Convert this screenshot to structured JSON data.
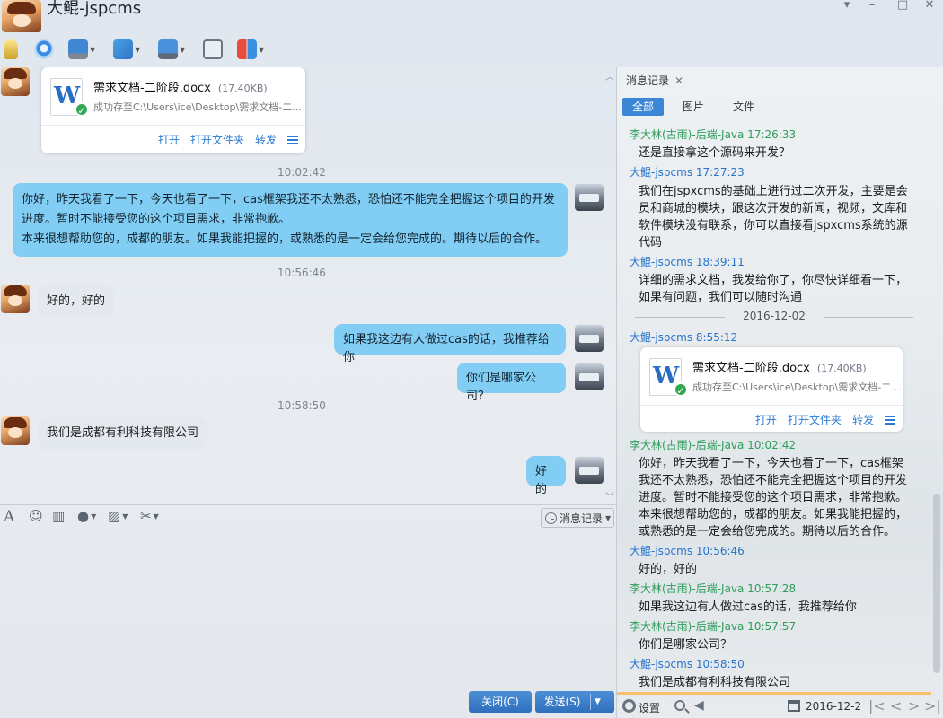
{
  "window": {
    "title": "大鲲-jspcms",
    "controls": [
      "▾",
      "–",
      "□",
      "✕"
    ]
  },
  "toolbar": {
    "items": [
      "mic-icon",
      "camera-icon",
      "screen-share-icon",
      "file-transfer-icon",
      "remote-desktop-icon",
      "message-add-icon",
      "apps-icon"
    ]
  },
  "chat": {
    "file_card": {
      "name": "需求文档-二阶段.docx",
      "size": "(17.40KB)",
      "saved": "成功存至C:\\Users\\ice\\Desktop\\需求文档-二...",
      "actions": [
        "打开",
        "打开文件夹",
        "转发"
      ]
    },
    "messages": [
      {
        "time": "10:02:42"
      },
      {
        "from": "self",
        "lines": [
          "你好，昨天我看了一下，今天也看了一下，cas框架我还不太熟悉，恐怕还不能完全把握这个项目的开发",
          "进度。暂时不能接受您的这个项目需求，非常抱歉。",
          "本来很想帮助您的，成都的朋友。如果我能把握的，或熟悉的是一定会给您完成的。期待以后的合作。"
        ]
      },
      {
        "time": "10:56:46"
      },
      {
        "from": "peer",
        "text": "好的，好的"
      },
      {
        "from": "self",
        "text": "如果我这边有人做过cas的话，我推荐给你"
      },
      {
        "from": "self",
        "text": "你们是哪家公司？"
      },
      {
        "time": "10:58:50"
      },
      {
        "from": "peer",
        "text": "我们是成都有利科技有限公司"
      },
      {
        "from": "self",
        "text": "好的"
      }
    ]
  },
  "input_bar": {
    "icons": [
      "font-icon",
      "emoji-icon",
      "screenshot-icon",
      "voice-icon",
      "image-icon",
      "scissors-icon"
    ],
    "history_button": "消息记录"
  },
  "buttons": {
    "close": "关闭(C)",
    "send": "发送(S)"
  },
  "history": {
    "tab_label": "消息记录",
    "filters": [
      "全部",
      "图片",
      "文件"
    ],
    "entries": [
      {
        "sender": "李大林(古雨)-后端-Java 17:26:33",
        "color": "green",
        "lines": [
          "还是直接拿这个源码来开发？"
        ]
      },
      {
        "sender": "大鲲-jspcms 17:27:23",
        "color": "blue",
        "lines": [
          "我们在jspxcms的基础上进行过二次开发，主要是会",
          "员和商城的模块，跟这次开发的新闻，视频，文库和",
          "软件模块没有联系，你可以直接看jspxcms系统的源",
          "代码"
        ]
      },
      {
        "sender": "大鲲-jspcms 18:39:11",
        "color": "blue",
        "lines": [
          "详细的需求文档，我发给你了，你尽快详细看一下，",
          "如果有问题，我们可以随时沟通"
        ]
      },
      {
        "date": "2016-12-02"
      },
      {
        "sender": "大鲲-jspcms 8:55:12",
        "color": "blue",
        "file": true
      },
      {
        "sender": "李大林(古雨)-后端-Java 10:02:42",
        "color": "green",
        "lines": [
          "你好，昨天我看了一下，今天也看了一下，cas框架",
          "我还不太熟悉，恐怕还不能完全把握这个项目的开发",
          "进度。暂时不能接受您的这个项目需求，非常抱歉。",
          "本来很想帮助您的，成都的朋友。如果我能把握的，",
          "或熟悉的是一定会给您完成的。期待以后的合作。"
        ]
      },
      {
        "sender": "大鲲-jspcms 10:56:46",
        "color": "blue",
        "lines": [
          "好的，好的"
        ]
      },
      {
        "sender": "李大林(古雨)-后端-Java 10:57:28",
        "color": "green",
        "lines": [
          "如果我这边有人做过cas的话，我推荐给你"
        ]
      },
      {
        "sender": "李大林(古雨)-后端-Java 10:57:57",
        "color": "green",
        "lines": [
          "你们是哪家公司？"
        ]
      },
      {
        "sender": "大鲲-jspcms 10:58:50",
        "color": "blue",
        "lines": [
          "我们是成都有利科技有限公司"
        ]
      }
    ],
    "bottom": {
      "settings_label": "设置",
      "date": "2016-12-2"
    }
  },
  "colors": {
    "bubble_out": "#82cdf3",
    "bubble_in": "#e3e9ef",
    "primary_button": "#3b7fcd",
    "sender_green": "#2e9d5b",
    "sender_blue": "#2773cc"
  }
}
